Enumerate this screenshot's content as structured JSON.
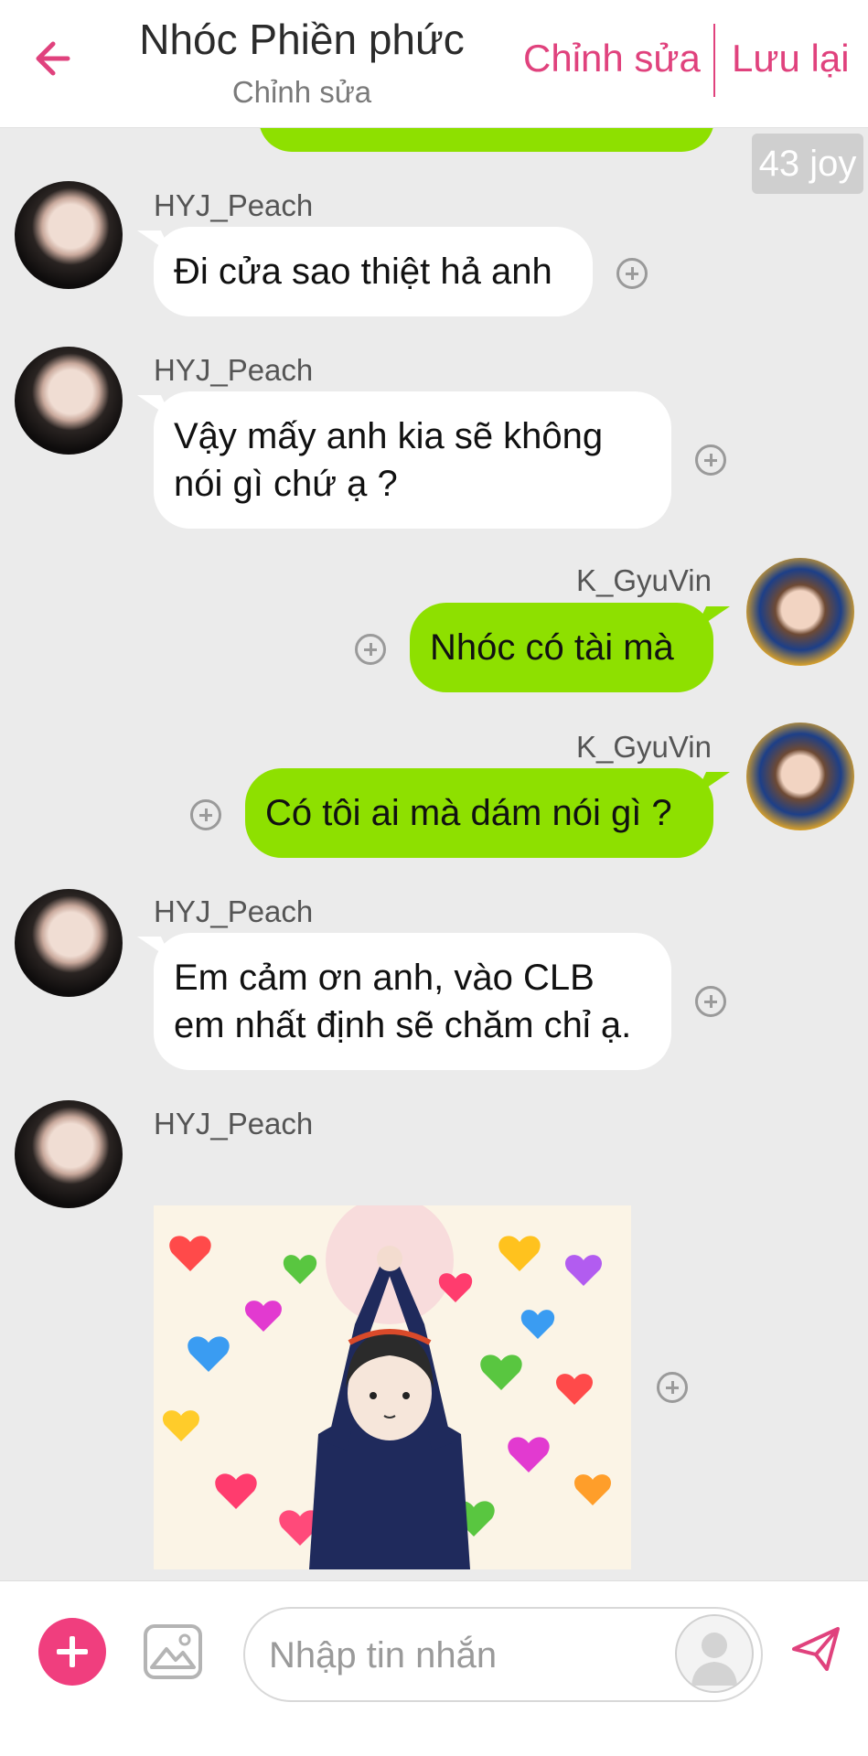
{
  "header": {
    "title": "Nhóc Phiền phức",
    "subtitle": "Chỉnh sửa",
    "edit_label": "Chỉnh sửa",
    "save_label": "Lưu lại",
    "accent_color": "#e0427d"
  },
  "joy_badge": "43 joy",
  "messages": [
    {
      "user": "HYJ_Peach",
      "side": "left",
      "lines": [
        "Đi cửa sao thiệt hả anh"
      ]
    },
    {
      "user": "HYJ_Peach",
      "side": "left",
      "lines": [
        "Vậy mấy anh kia sẽ không",
        "nói gì chứ ạ ?"
      ]
    },
    {
      "user": "K_GyuVin",
      "side": "right",
      "lines": [
        "Nhóc có tài mà"
      ]
    },
    {
      "user": "K_GyuVin",
      "side": "right",
      "lines": [
        "Có tôi ai mà dám nói gì ?"
      ]
    },
    {
      "user": "HYJ_Peach",
      "side": "left",
      "lines": [
        "Em cảm ơn anh, vào CLB",
        "em nhất định sẽ chăm chỉ ạ."
      ]
    },
    {
      "user": "HYJ_Peach",
      "side": "left",
      "sticker": "hearts-sticker"
    }
  ],
  "composer": {
    "placeholder": "Nhập tin nhắn"
  },
  "colors": {
    "outgoing_bubble": "#8ee000",
    "incoming_bubble": "#ffffff",
    "background": "#ebebeb",
    "add_button": "#f03e7e"
  },
  "icons": {
    "back": "arrow-left-icon",
    "add": "plus-icon",
    "image": "image-icon",
    "send": "send-icon",
    "reaction": "plus-circle-icon"
  }
}
